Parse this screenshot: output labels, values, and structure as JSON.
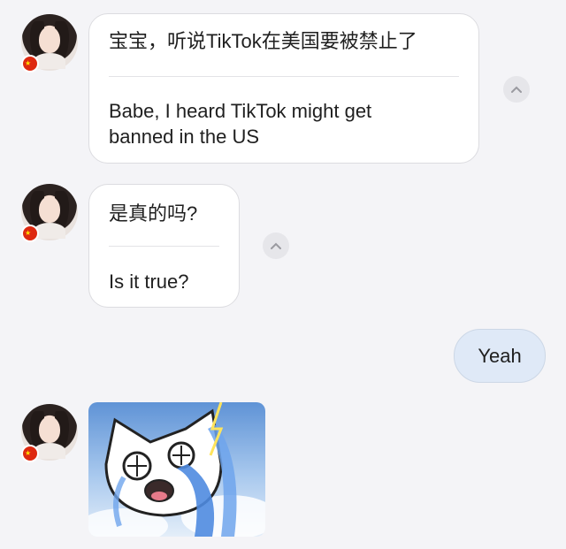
{
  "messages": [
    {
      "sender": "contact",
      "original": "宝宝，听说TikTok在美国要被禁止了",
      "translation": "Babe, I heard TikTok might get\nbanned in the US"
    },
    {
      "sender": "contact",
      "original": "是真的吗?",
      "translation": "Is it true?"
    },
    {
      "sender": "me",
      "text": "Yeah"
    },
    {
      "sender": "contact",
      "type": "sticker",
      "sticker_name": "crying-cat-sticker"
    }
  ],
  "icons": {
    "collapse": "chevron-up-icon",
    "flag": "china-flag-icon"
  },
  "colors": {
    "background": "#f4f4f7",
    "sent_bubble": "#dfe9f7",
    "received_bubble": "#ffffff"
  }
}
